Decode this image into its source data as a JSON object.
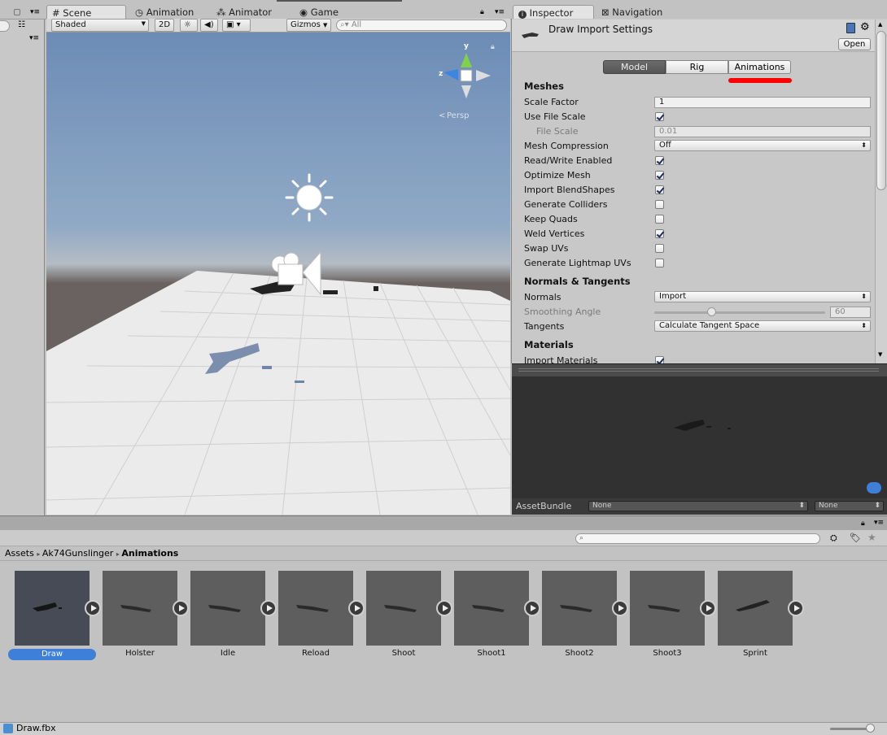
{
  "tabs": {
    "scene": "Scene",
    "animation": "Animation",
    "animator": "Animator",
    "game": "Game",
    "inspector": "Inspector",
    "navigation": "Navigation"
  },
  "scene_toolbar": {
    "shading_mode": "Shaded",
    "mode_2d": "2D",
    "gizmos": "Gizmos",
    "search_placeholder": "All"
  },
  "scene_view": {
    "persp_label": "Persp",
    "gizmo_y": "y",
    "gizmo_z": "z"
  },
  "inspector": {
    "title": "Draw Import Settings",
    "open_button": "Open",
    "tabs": [
      "Model",
      "Rig",
      "Animations"
    ],
    "sections": {
      "meshes": "Meshes",
      "normals_tangents": "Normals & Tangents",
      "materials": "Materials"
    },
    "props": {
      "scale_factor": {
        "label": "Scale Factor",
        "value": "1"
      },
      "use_file_scale": {
        "label": "Use File Scale",
        "checked": true
      },
      "file_scale": {
        "label": "File Scale",
        "value": "0.01"
      },
      "mesh_compression": {
        "label": "Mesh Compression",
        "value": "Off"
      },
      "read_write": {
        "label": "Read/Write Enabled",
        "checked": true
      },
      "optimize_mesh": {
        "label": "Optimize Mesh",
        "checked": true
      },
      "import_blendshapes": {
        "label": "Import BlendShapes",
        "checked": true
      },
      "generate_colliders": {
        "label": "Generate Colliders",
        "checked": false
      },
      "keep_quads": {
        "label": "Keep Quads",
        "checked": false
      },
      "weld_vertices": {
        "label": "Weld Vertices",
        "checked": true
      },
      "swap_uvs": {
        "label": "Swap UVs",
        "checked": false
      },
      "lightmap_uvs": {
        "label": "Generate Lightmap UVs",
        "checked": false
      },
      "normals": {
        "label": "Normals",
        "value": "Import"
      },
      "smoothing_angle": {
        "label": "Smoothing Angle",
        "value": "60"
      },
      "tangents": {
        "label": "Tangents",
        "value": "Calculate Tangent Space"
      },
      "import_materials": {
        "label": "Import Materials",
        "checked": true
      }
    },
    "assetbundle": {
      "label": "AssetBundle",
      "name": "None",
      "variant": "None"
    }
  },
  "project": {
    "breadcrumb": [
      "Assets",
      "Ak74Gunslinger",
      "Animations"
    ],
    "assets": [
      "Draw",
      "Holster",
      "Idle",
      "Reload",
      "Shoot",
      "Shoot1",
      "Shoot2",
      "Shoot3",
      "Sprint"
    ],
    "selected_asset": "Draw",
    "status_file": "Draw.fbx"
  },
  "colors": {
    "annotation_underline": "#ff0000",
    "selection": "#3d7fd9"
  }
}
